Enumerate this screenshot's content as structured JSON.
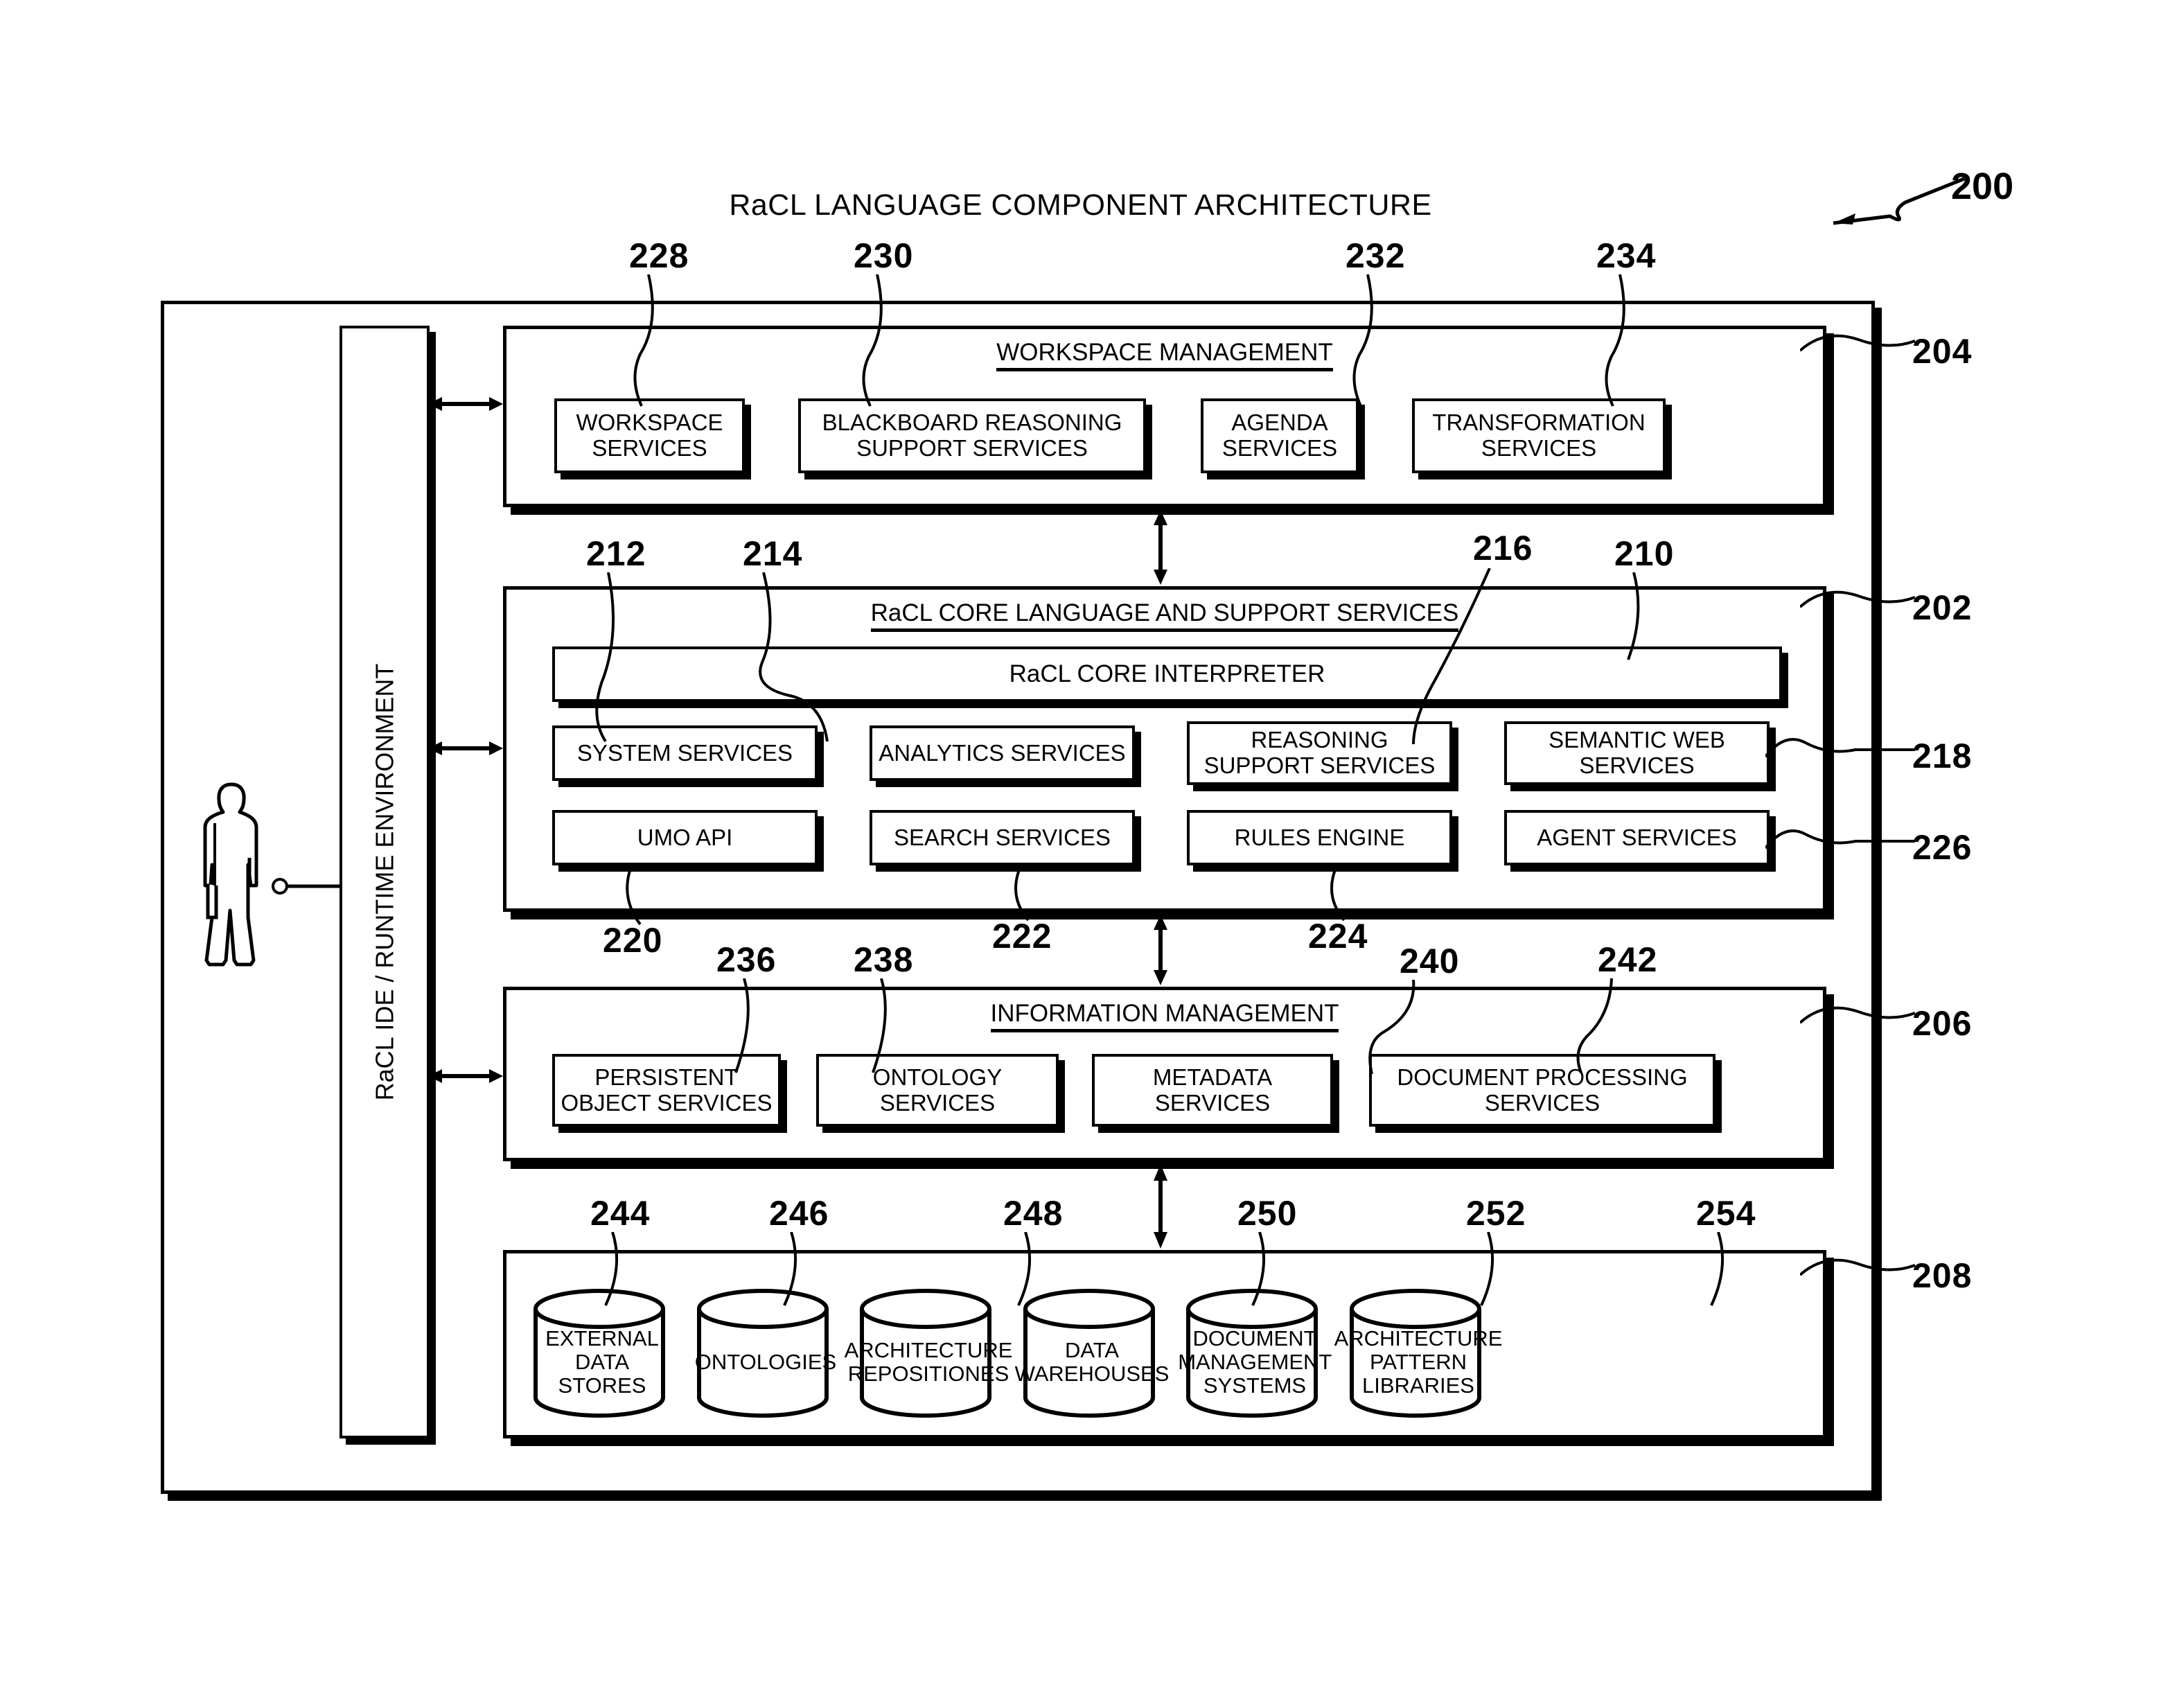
{
  "figure": {
    "title": "RaCL LANGUAGE COMPONENT ARCHITECTURE",
    "figure_number": "200"
  },
  "actor": {
    "name": "user-figure"
  },
  "ide_bar": {
    "label": "RaCL IDE / RUNTIME ENVIRONMENT",
    "ref": "202_container"
  },
  "layers": {
    "workspace": {
      "title": "WORKSPACE MANAGEMENT",
      "ref": "204",
      "boxes": [
        {
          "label": "WORKSPACE SERVICES",
          "ref": "228"
        },
        {
          "label": "BLACKBOARD REASONING SUPPORT SERVICES",
          "ref": "230"
        },
        {
          "label": "AGENDA SERVICES",
          "ref": "232"
        },
        {
          "label": "TRANSFORMATION SERVICES",
          "ref": "234"
        }
      ]
    },
    "core": {
      "title": "RaCL CORE LANGUAGE AND SUPPORT SERVICES",
      "ref": "202",
      "interpreter": {
        "label": "RaCL CORE INTERPRETER",
        "ref": "210"
      },
      "boxes": [
        {
          "label": "SYSTEM SERVICES",
          "ref": "212"
        },
        {
          "label": "ANALYTICS SERVICES",
          "ref": "214"
        },
        {
          "label": "REASONING SUPPORT SERVICES",
          "ref": "216"
        },
        {
          "label": "SEMANTIC WEB SERVICES",
          "ref": "218"
        },
        {
          "label": "UMO API",
          "ref": "220"
        },
        {
          "label": "SEARCH SERVICES",
          "ref": "222"
        },
        {
          "label": "RULES ENGINE",
          "ref": "224"
        },
        {
          "label": "AGENT SERVICES",
          "ref": "226"
        }
      ]
    },
    "information": {
      "title": "INFORMATION MANAGEMENT",
      "ref": "206",
      "boxes": [
        {
          "label": "PERSISTENT OBJECT SERVICES",
          "ref": "236"
        },
        {
          "label": "ONTOLOGY SERVICES",
          "ref": "238"
        },
        {
          "label": "METADATA SERVICES",
          "ref": "240"
        },
        {
          "label": "DOCUMENT PROCESSING SERVICES",
          "ref": "242"
        }
      ]
    },
    "stores": {
      "ref": "208",
      "cylinders": [
        {
          "label": "EXTERNAL DATA STORES",
          "ref": "244"
        },
        {
          "label": "ONTOLOGIES",
          "ref": "246"
        },
        {
          "label": "ARCHITECTURE REPOSITIONES",
          "ref": "248"
        },
        {
          "label": "DATA WAREHOUSES",
          "ref": "250"
        },
        {
          "label": "DOCUMENT MANAGEMENT SYSTEMS",
          "ref": "252"
        },
        {
          "label": "ARCHITECTURE PATTERN LIBRARIES",
          "ref": "254"
        }
      ]
    }
  },
  "refs": {
    "r200": "200",
    "r202": "202",
    "r204": "204",
    "r206": "206",
    "r208": "208",
    "r210": "210",
    "r212": "212",
    "r214": "214",
    "r216": "216",
    "r218": "218",
    "r220": "220",
    "r222": "222",
    "r224": "224",
    "r226": "226",
    "r228": "228",
    "r230": "230",
    "r232": "232",
    "r234": "234",
    "r236": "236",
    "r238": "238",
    "r240": "240",
    "r242": "242",
    "r244": "244",
    "r246": "246",
    "r248": "248",
    "r250": "250",
    "r252": "252",
    "r254": "254"
  },
  "colors": {
    "ink": "#000000",
    "paper": "#ffffff"
  }
}
